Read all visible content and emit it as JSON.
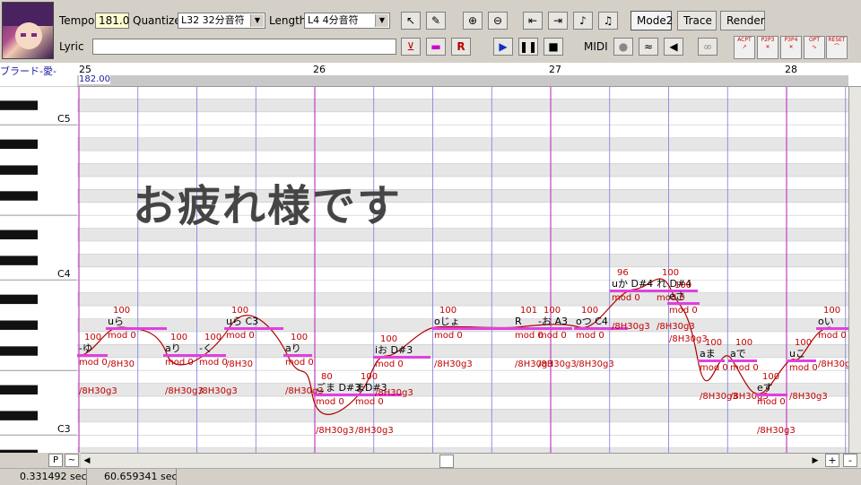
{
  "toolbar": {
    "tempo_label": "Tempo",
    "tempo_value": "181.0",
    "quantize_label": "Quantize",
    "quantize_value": "L32 32分音符",
    "length_label": "Length",
    "length_value": "L4  4分音符",
    "lyric_label": "Lyric",
    "lyric_value": "",
    "midi_label": "MIDI",
    "mode_label": "Mode2",
    "trace_label": "Trace",
    "render_label": "Render",
    "icons": [
      "pointer-icon",
      "pencil-icon",
      "zoom-in-icon",
      "zoom-out-icon",
      "go-start-icon",
      "go-end-icon",
      "prev-note-icon",
      "next-note-icon",
      "insert-rest-icon",
      "insert-note-icon",
      "insert-r-icon",
      "play-icon",
      "pause-icon",
      "stop-icon",
      "midi-record-icon",
      "midi-wave-icon",
      "speaker-icon",
      "loop-icon"
    ],
    "small_labels": [
      "ACPT",
      "P2P3",
      "P3P4",
      "OPT",
      "RESET"
    ]
  },
  "track": {
    "name": "ブラード-愛-",
    "start_tempo": "182.00",
    "measures": [
      "25",
      "26",
      "27",
      "28"
    ]
  },
  "keys": {
    "labels": [
      "C5",
      "C4",
      "C3"
    ]
  },
  "overlay_text": "お疲れ様です",
  "notes": [
    {
      "lyric": "-ゆ",
      "vel": "100",
      "mod": "mod 0",
      "env": "/8H30g3"
    },
    {
      "lyric": "uら",
      "vel": "100",
      "mod": "mod 0",
      "env": "/8H30"
    },
    {
      "lyric": "aり",
      "vel": "100",
      "mod": "mod 0",
      "env": "/8H30g3"
    },
    {
      "lyric": "-く",
      "vel": "100",
      "mod": "mod 0",
      "env": "/8H30g3"
    },
    {
      "lyric": "uら C3",
      "vel": "100",
      "mod": "mod 0",
      "env": "/8H30"
    },
    {
      "lyric": "aり",
      "vel": "100",
      "mod": "mod 0",
      "env": "/8H30g3"
    },
    {
      "lyric": "ごま D#3",
      "vel": "80",
      "mod": "mod 0",
      "env": "/8H30g3"
    },
    {
      "lyric": "まD#3",
      "vel": "100",
      "mod": "mod 0",
      "env": "/8H30g3"
    },
    {
      "lyric": "iお D#3",
      "vel": "100",
      "mod": "mod 0",
      "env": "/8H30g3"
    },
    {
      "lyric": "oじょ",
      "vel": "100",
      "mod": "mod 0",
      "env": "/8H30g3"
    },
    {
      "lyric": "R",
      "vel": "101",
      "mod": "mod 0",
      "env": "/8H30g3"
    },
    {
      "lyric": "-お A3",
      "vel": "100",
      "mod": "mod 0",
      "env": "/8H30g3"
    },
    {
      "lyric": "oつ C4",
      "vel": "100",
      "mod": "mod 0",
      "env": "/8H30g3"
    },
    {
      "lyric": "uか D#4",
      "vel": "96",
      "mod": "mod 0",
      "env": "/8H30g3"
    },
    {
      "lyric": "れ D#4",
      "vel": "100",
      "mod": "mod 0",
      "env": "/8H30g3"
    },
    {
      "lyric": "eさ",
      "vel": "100",
      "mod": "mod 0",
      "env": "/8H30g3"
    },
    {
      "lyric": "aま",
      "vel": "100",
      "mod": "mod 0",
      "env": "/8H30g3"
    },
    {
      "lyric": "aで",
      "vel": "100",
      "mod": "mod 0",
      "env": "/8H30g3"
    },
    {
      "lyric": "eす",
      "vel": "100",
      "mod": "mod 0",
      "env": "/8H30g3"
    },
    {
      "lyric": "uこ",
      "vel": "100",
      "mod": "mod 0",
      "env": "/8H30g3"
    },
    {
      "lyric": "oい",
      "vel": "100",
      "mod": "mod 0",
      "env": "/8H30g3"
    }
  ],
  "scroll": {
    "p_label": "P",
    "tilde_label": "~",
    "plus_label": "+",
    "minus_label": "-"
  },
  "status": {
    "cursor_time": "0.331492 sec",
    "total_time": "60.659341 sec"
  }
}
